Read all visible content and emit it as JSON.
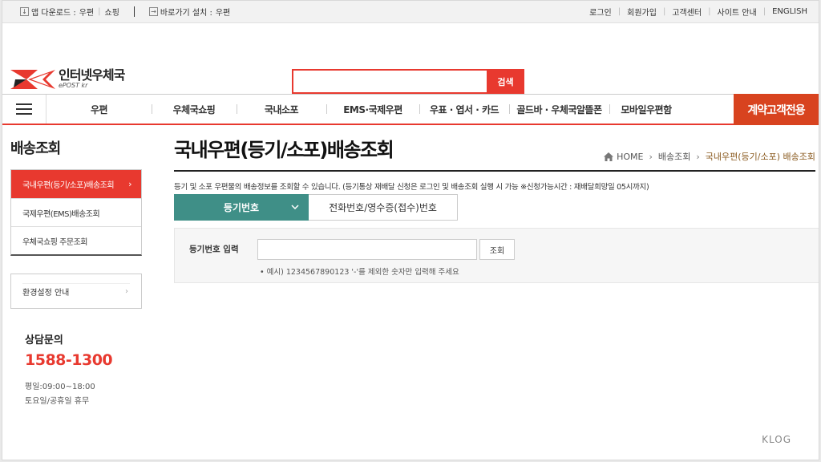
{
  "utilbar": {
    "app_download_label": "앱 다운로드 :",
    "app_links": [
      "우편",
      "쇼핑"
    ],
    "shortcut_label": "바로가기 설치 :",
    "shortcut_link": "우편",
    "right_links": [
      "로그인",
      "회원가입",
      "고객센터",
      "사이트 안내",
      "ENGLISH"
    ]
  },
  "header": {
    "logo_ko": "인터넷우체국",
    "logo_en": "ePOST kr",
    "search_button": "검색",
    "search_value": ""
  },
  "gnb": {
    "items": [
      "우편",
      "우체국쇼핑",
      "국내소포",
      "EMS·국제우편",
      "우표 · 엽서 · 카드",
      "골드바 · 우체국알뜰폰",
      "모바일우편함"
    ],
    "cta": "계약고객전용"
  },
  "sidebar": {
    "title": "배송조회",
    "items": [
      "국내우편(등기/소포)배송조회",
      "국제우편(EMS)배송조회",
      "우체국쇼핑 주문조회"
    ],
    "active_arrow": "›",
    "env_label": "환경설정 안내",
    "env_arrow": "›",
    "consult_title": "상담문의",
    "consult_phone": "1588-1300",
    "hours_weekday": "평일:09:00~18:00",
    "hours_holiday": "토요일/공휴일 휴무"
  },
  "main": {
    "title": "국내우편(등기/소포)배송조회",
    "breadcrumb": [
      "HOME",
      "배송조회",
      "국내우편(등기/소포) 배송조회"
    ],
    "breadcrumb_sep": "›",
    "description": "등기 및 소포 우편물의 배송정보를 조회할 수 있습니다. (등기통상 재배달 신청은 로그인 및 배송조회 실행 시 가능 ※신청가능시간 : 재배달희망일 05시까지)",
    "tabs": [
      "등기번호",
      "전화번호/영수증(접수)번호"
    ],
    "form_label": "등기번호 입력",
    "form_value": "",
    "form_button": "조회",
    "form_hint": "• 예시) 1234567890123 '-'를 제외한 숫자만 입력해 주세요"
  },
  "watermark": "KLOG",
  "colors": {
    "accent_red": "#e8392f",
    "cta_orange": "#d8431f",
    "tab_teal": "#3f8f87"
  }
}
